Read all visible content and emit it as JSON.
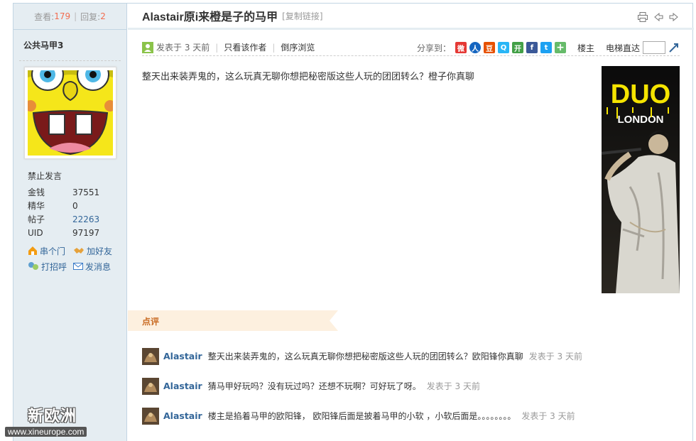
{
  "stats": {
    "views_label": "查看:",
    "views": "179",
    "replies_label": "回复:",
    "replies": "2"
  },
  "author": {
    "name": "公共马甲3",
    "status": "禁止发言",
    "fields": [
      {
        "key": "金钱",
        "value": "37551",
        "link": false
      },
      {
        "key": "精华",
        "value": "0",
        "link": false
      },
      {
        "key": "帖子",
        "value": "22263",
        "link": true
      },
      {
        "key": "UID",
        "value": "97197",
        "link": false
      }
    ],
    "actions": {
      "visit": "串个门",
      "add_friend": "加好友",
      "greet": "打招呼",
      "message": "发消息"
    }
  },
  "thread": {
    "title": "Alastair原i来橙是子的马甲",
    "copy_link": "[复制链接]"
  },
  "post": {
    "posted": "发表于 3 天前",
    "author_only": "只看该作者",
    "reverse": "倒序浏览",
    "share_label": "分享到：",
    "floor": "楼主",
    "jump_label": "电梯直达",
    "content": "整天出来装弄鬼的，这么玩真无聊你想把秘密版这些人玩的团团转么？橙子你真聊"
  },
  "ad": {
    "line1": "DUO",
    "line2": "LONDON"
  },
  "comments_label": "点评",
  "comments": [
    {
      "name": "Alastair",
      "text": "整天出来装弄鬼的，这么玩真无聊你想把秘密版这些人玩的团团转么？欧阳锋你真聊",
      "time": "发表于 3 天前"
    },
    {
      "name": "Alastair",
      "text": "猜马甲好玩吗？没有玩过吗？还想不玩啊？可好玩了呀。",
      "time": "发表于 3 天前"
    },
    {
      "name": "Alastair",
      "text": "楼主是掐着马甲的欧阳锋， 欧阳锋后面是披着马甲的小软 ，小软后面是。。。。。。。。",
      "time": "发表于 3 天前"
    }
  ],
  "watermark": {
    "logo": "新欧洲",
    "url": "www.xineurope.com"
  },
  "colors": {
    "link": "#336699",
    "count": "#f26c4f",
    "sidebar_bg": "#e5edf2",
    "comment_tag": "#c96b23"
  }
}
